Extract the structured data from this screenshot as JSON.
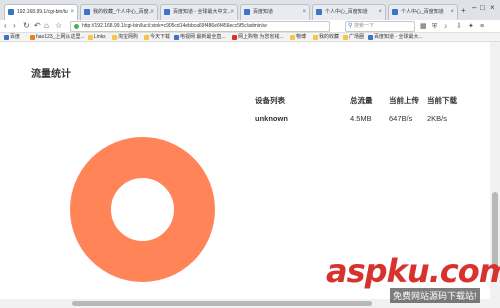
{
  "browser": {
    "tabs": [
      {
        "title": "192.168.99.1/cgi-bin/lu",
        "active": true
      },
      {
        "title": "我的收藏_个人中心_百度..."
      },
      {
        "title": "百度知道 - 全球最大中文..."
      },
      {
        "title": "百度知道"
      },
      {
        "title": "个人中心_百度知道"
      },
      {
        "title": "个人中心_百度知道"
      }
    ],
    "new_tab_glyph": "+",
    "url": "http://192.168.99.1/cgi-bin/luci/;stok=c905cd14ebbca69f486e6f456ecc5f5c/admin/w",
    "search_placeholder": "搜索一下",
    "bookmarks": [
      {
        "label": "百度",
        "icon_color": "#3b73c8"
      },
      {
        "label": "hao123_上网从这里...",
        "icon_color": "#e9811d"
      },
      {
        "label": "Links",
        "icon_color": "#f2c744"
      },
      {
        "label": "淘宝网购",
        "icon_color": "#f2c744"
      },
      {
        "label": "今天下载",
        "icon_color": "#f2c744"
      },
      {
        "label": "电视网 最新最全直...",
        "icon_color": "#3b73c8"
      },
      {
        "label": "网上购物 为您省钱...",
        "icon_color": "#d8322c"
      },
      {
        "label": "物博",
        "icon_color": "#f2c744"
      },
      {
        "label": "我的收藏",
        "icon_color": "#f2c744"
      },
      {
        "label": "广场圈",
        "icon_color": "#f2c744"
      },
      {
        "label": "百度知道 - 全球最大...",
        "icon_color": "#3b73c8"
      }
    ]
  },
  "section": {
    "title": "流量统计"
  },
  "table": {
    "headers": [
      "设备列表",
      "总流量",
      "当前上传",
      "当前下载"
    ],
    "rows": [
      [
        "unknown",
        "4.5MB",
        "647B/s",
        "2KB/s"
      ]
    ]
  },
  "colors": {
    "donut": "#ff8559",
    "watermark_red": "#d8322c"
  },
  "watermark": {
    "logo": "aspku.com",
    "subtitle": "免费网站源码下载站!"
  }
}
